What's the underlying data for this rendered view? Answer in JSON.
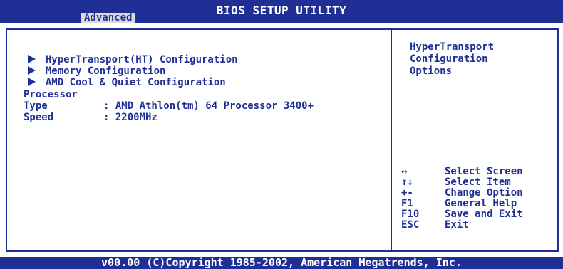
{
  "header": {
    "title": "BIOS SETUP UTILITY",
    "active_tab": "Advanced"
  },
  "menu": {
    "items": [
      {
        "label": "HyperTransport(HT) Configuration",
        "icon": "triangle-right-icon"
      },
      {
        "label": "Memory Configuration",
        "icon": "triangle-right-icon"
      },
      {
        "label": "AMD Cool & Quiet Configuration",
        "icon": "triangle-right-icon"
      }
    ]
  },
  "processor": {
    "heading": "Processor",
    "type_label": "Type",
    "type_value": ": AMD Athlon(tm) 64 Processor 3400+",
    "speed_label": "Speed",
    "speed_value": ": 2200MHz"
  },
  "help": {
    "lines": [
      "HyperTransport",
      "Configuration",
      "Options"
    ]
  },
  "keys": [
    {
      "key": "↔",
      "desc": "Select Screen"
    },
    {
      "key": "↑↓",
      "desc": "Select Item"
    },
    {
      "key": "+-",
      "desc": "Change Option"
    },
    {
      "key": "F1",
      "desc": "General Help"
    },
    {
      "key": "F10",
      "desc": "Save and Exit"
    },
    {
      "key": "ESC",
      "desc": "Exit"
    }
  ],
  "footer": {
    "copyright": "v00.00 (C)Copyright 1985-2002, American Megatrends, Inc."
  },
  "colors": {
    "accent": "#1f2f96",
    "background": "#ffffff",
    "tab_background": "#d9d9d9"
  }
}
